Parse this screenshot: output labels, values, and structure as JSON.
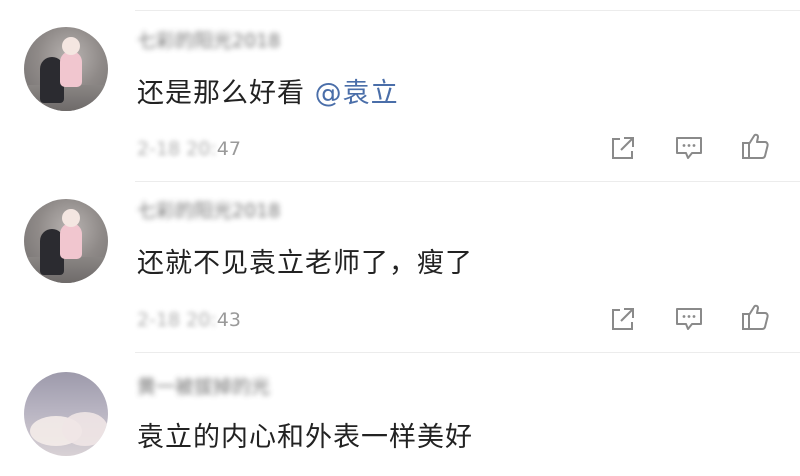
{
  "comments": [
    {
      "username": "七彩的阳光2018",
      "text": "还是那么好看 ",
      "mention": "@袁立",
      "timestamp_blurred": "2-18 20:",
      "timestamp_visible": "47",
      "avatar_icon": "avatar-photo-icon"
    },
    {
      "username": "七彩的阳光2018",
      "text": "还就不见袁立老师了，瘦了",
      "mention": "",
      "timestamp_blurred": "2-18 20:",
      "timestamp_visible": "43",
      "avatar_icon": "avatar-photo-icon"
    },
    {
      "username": "黄一被拔掉的光",
      "text": "袁立的内心和外表一样美好",
      "mention": "",
      "avatar_icon": "avatar-sky-icon"
    }
  ],
  "actions": {
    "share_icon": "share-icon",
    "comment_icon": "comment-icon",
    "like_icon": "thumbs-up-icon"
  },
  "colors": {
    "mention": "#4a6ea9",
    "icon": "#8a8a8a",
    "text": "#222222",
    "divider": "#ececec"
  }
}
